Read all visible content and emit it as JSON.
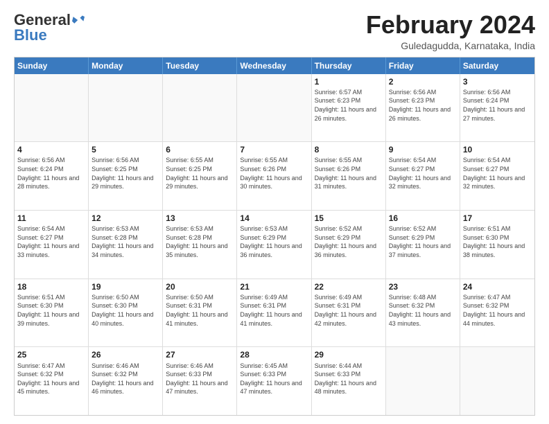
{
  "logo": {
    "text_general": "General",
    "text_blue": "Blue",
    "icon_color": "#3a7abf"
  },
  "title": "February 2024",
  "location": "Guledagudda, Karnataka, India",
  "header": {
    "days": [
      "Sunday",
      "Monday",
      "Tuesday",
      "Wednesday",
      "Thursday",
      "Friday",
      "Saturday"
    ]
  },
  "weeks": [
    {
      "cells": [
        {
          "day": "",
          "info": ""
        },
        {
          "day": "",
          "info": ""
        },
        {
          "day": "",
          "info": ""
        },
        {
          "day": "",
          "info": ""
        },
        {
          "day": "1",
          "info": "Sunrise: 6:57 AM\nSunset: 6:23 PM\nDaylight: 11 hours and 26 minutes."
        },
        {
          "day": "2",
          "info": "Sunrise: 6:56 AM\nSunset: 6:23 PM\nDaylight: 11 hours and 26 minutes."
        },
        {
          "day": "3",
          "info": "Sunrise: 6:56 AM\nSunset: 6:24 PM\nDaylight: 11 hours and 27 minutes."
        }
      ]
    },
    {
      "cells": [
        {
          "day": "4",
          "info": "Sunrise: 6:56 AM\nSunset: 6:24 PM\nDaylight: 11 hours and 28 minutes."
        },
        {
          "day": "5",
          "info": "Sunrise: 6:56 AM\nSunset: 6:25 PM\nDaylight: 11 hours and 29 minutes."
        },
        {
          "day": "6",
          "info": "Sunrise: 6:55 AM\nSunset: 6:25 PM\nDaylight: 11 hours and 29 minutes."
        },
        {
          "day": "7",
          "info": "Sunrise: 6:55 AM\nSunset: 6:26 PM\nDaylight: 11 hours and 30 minutes."
        },
        {
          "day": "8",
          "info": "Sunrise: 6:55 AM\nSunset: 6:26 PM\nDaylight: 11 hours and 31 minutes."
        },
        {
          "day": "9",
          "info": "Sunrise: 6:54 AM\nSunset: 6:27 PM\nDaylight: 11 hours and 32 minutes."
        },
        {
          "day": "10",
          "info": "Sunrise: 6:54 AM\nSunset: 6:27 PM\nDaylight: 11 hours and 32 minutes."
        }
      ]
    },
    {
      "cells": [
        {
          "day": "11",
          "info": "Sunrise: 6:54 AM\nSunset: 6:27 PM\nDaylight: 11 hours and 33 minutes."
        },
        {
          "day": "12",
          "info": "Sunrise: 6:53 AM\nSunset: 6:28 PM\nDaylight: 11 hours and 34 minutes."
        },
        {
          "day": "13",
          "info": "Sunrise: 6:53 AM\nSunset: 6:28 PM\nDaylight: 11 hours and 35 minutes."
        },
        {
          "day": "14",
          "info": "Sunrise: 6:53 AM\nSunset: 6:29 PM\nDaylight: 11 hours and 36 minutes."
        },
        {
          "day": "15",
          "info": "Sunrise: 6:52 AM\nSunset: 6:29 PM\nDaylight: 11 hours and 36 minutes."
        },
        {
          "day": "16",
          "info": "Sunrise: 6:52 AM\nSunset: 6:29 PM\nDaylight: 11 hours and 37 minutes."
        },
        {
          "day": "17",
          "info": "Sunrise: 6:51 AM\nSunset: 6:30 PM\nDaylight: 11 hours and 38 minutes."
        }
      ]
    },
    {
      "cells": [
        {
          "day": "18",
          "info": "Sunrise: 6:51 AM\nSunset: 6:30 PM\nDaylight: 11 hours and 39 minutes."
        },
        {
          "day": "19",
          "info": "Sunrise: 6:50 AM\nSunset: 6:30 PM\nDaylight: 11 hours and 40 minutes."
        },
        {
          "day": "20",
          "info": "Sunrise: 6:50 AM\nSunset: 6:31 PM\nDaylight: 11 hours and 41 minutes."
        },
        {
          "day": "21",
          "info": "Sunrise: 6:49 AM\nSunset: 6:31 PM\nDaylight: 11 hours and 41 minutes."
        },
        {
          "day": "22",
          "info": "Sunrise: 6:49 AM\nSunset: 6:31 PM\nDaylight: 11 hours and 42 minutes."
        },
        {
          "day": "23",
          "info": "Sunrise: 6:48 AM\nSunset: 6:32 PM\nDaylight: 11 hours and 43 minutes."
        },
        {
          "day": "24",
          "info": "Sunrise: 6:47 AM\nSunset: 6:32 PM\nDaylight: 11 hours and 44 minutes."
        }
      ]
    },
    {
      "cells": [
        {
          "day": "25",
          "info": "Sunrise: 6:47 AM\nSunset: 6:32 PM\nDaylight: 11 hours and 45 minutes."
        },
        {
          "day": "26",
          "info": "Sunrise: 6:46 AM\nSunset: 6:32 PM\nDaylight: 11 hours and 46 minutes."
        },
        {
          "day": "27",
          "info": "Sunrise: 6:46 AM\nSunset: 6:33 PM\nDaylight: 11 hours and 47 minutes."
        },
        {
          "day": "28",
          "info": "Sunrise: 6:45 AM\nSunset: 6:33 PM\nDaylight: 11 hours and 47 minutes."
        },
        {
          "day": "29",
          "info": "Sunrise: 6:44 AM\nSunset: 6:33 PM\nDaylight: 11 hours and 48 minutes."
        },
        {
          "day": "",
          "info": ""
        },
        {
          "day": "",
          "info": ""
        }
      ]
    }
  ]
}
